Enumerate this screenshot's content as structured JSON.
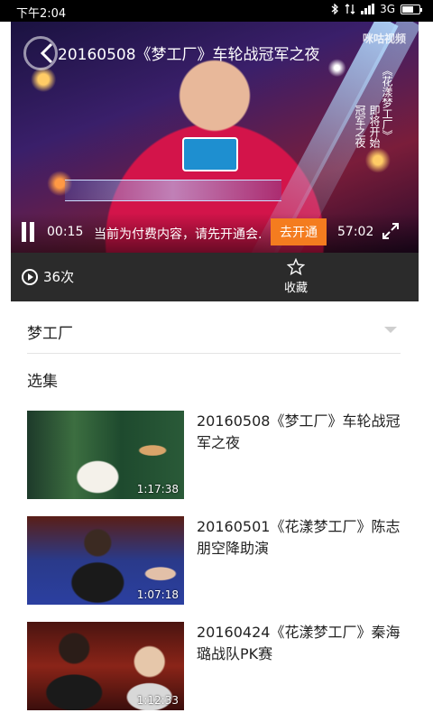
{
  "status_bar": {
    "time": "下午2:04",
    "network": "3G"
  },
  "player": {
    "title": "20160508《梦工厂》车轮战冠军之夜",
    "watermark": "咪咕视频",
    "overlay_text": [
      "《花漾梦工厂》",
      "即将开始",
      "冠军之夜"
    ],
    "current_time": "00:15",
    "pay_message": "当前为付费内容，请先开通会.",
    "open_button": "去开通",
    "duration": "57:02"
  },
  "info_bar": {
    "play_count": "36次",
    "favorite_label": "收藏"
  },
  "program": {
    "name": "梦工厂"
  },
  "episodes_label": "选集",
  "episodes": [
    {
      "title": "20160508《梦工厂》车轮战冠军之夜",
      "duration": "1:17:38"
    },
    {
      "title": "20160501《花漾梦工厂》陈志朋空降助演",
      "duration": "1:07:18"
    },
    {
      "title": "20160424《花漾梦工厂》秦海璐战队PK赛",
      "duration": "1:12:33"
    }
  ],
  "colors": {
    "accent": "#f47c1f",
    "info_bar_bg": "#2b2b2b"
  }
}
